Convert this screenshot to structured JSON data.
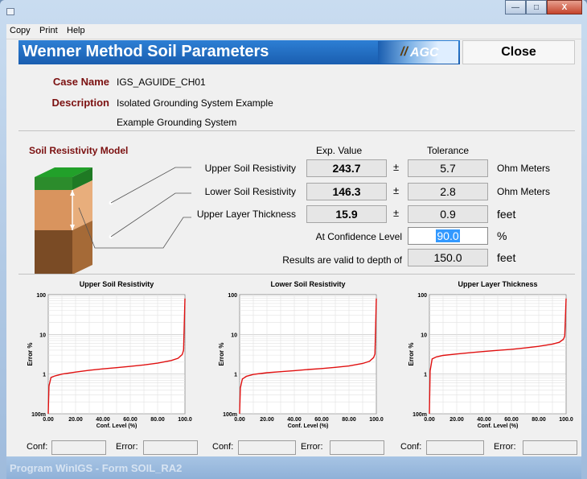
{
  "window": {
    "minimize": "—",
    "maximize": "□",
    "close": "X"
  },
  "menu": [
    "Copy",
    "Print",
    "Help"
  ],
  "header": {
    "title": "Wenner Method Soil Parameters",
    "logo": "AGC",
    "close_label": "Close"
  },
  "case": {
    "name_label": "Case Name",
    "name_value": "IGS_AGUIDE_CH01",
    "desc_label": "Description",
    "desc_value1": "Isolated Grounding System Example",
    "desc_value2": "Example Grounding System"
  },
  "model": {
    "title": "Soil Resistivity Model",
    "col_exp": "Exp. Value",
    "col_tol": "Tolerance",
    "rows": [
      {
        "label": "Upper Soil Resistivity",
        "value": "243.7",
        "pm": "±",
        "tol": "5.7",
        "unit": "Ohm Meters"
      },
      {
        "label": "Lower Soil Resistivity",
        "value": "146.3",
        "pm": "±",
        "tol": "2.8",
        "unit": "Ohm Meters"
      },
      {
        "label": "Upper Layer Thickness",
        "value": "15.9",
        "pm": "±",
        "tol": "0.9",
        "unit": "feet"
      }
    ],
    "confidence_label": "At Confidence Level",
    "confidence_value": "90.0",
    "confidence_unit": "%",
    "depth_label": "Results are valid to depth of",
    "depth_value": "150.0",
    "depth_unit": "feet"
  },
  "charts_text": {
    "ytick_labels": [
      "100",
      "10",
      "1",
      "100m"
    ],
    "xtick_labels": [
      "0.00",
      "20.00",
      "40.00",
      "60.00",
      "80.00",
      "100.0"
    ],
    "ylabel": "Error %",
    "xlabel": "Conf. Level (%)"
  },
  "chart_data": [
    {
      "type": "line",
      "title": "Upper Soil Resistivity",
      "xlabel": "Conf. Level (%)",
      "ylabel": "Error %",
      "xlim": [
        0,
        100
      ],
      "ylim": [
        0.1,
        100
      ],
      "y_scale": "log",
      "grid": true,
      "color": "#e01010",
      "x": [
        0,
        0.5,
        2,
        5,
        10,
        20,
        30,
        40,
        50,
        60,
        70,
        80,
        90,
        95,
        98,
        99,
        100
      ],
      "y": [
        0.1,
        0.5,
        0.82,
        0.9,
        1.0,
        1.12,
        1.25,
        1.35,
        1.45,
        1.56,
        1.7,
        1.88,
        2.2,
        2.5,
        3.1,
        4.0,
        80
      ]
    },
    {
      "type": "line",
      "title": "Lower Soil Resistivity",
      "xlabel": "Conf. Level (%)",
      "ylabel": "Error %",
      "xlim": [
        0,
        100
      ],
      "ylim": [
        0.1,
        100
      ],
      "y_scale": "log",
      "grid": true,
      "color": "#e01010",
      "x": [
        0,
        0.5,
        2,
        5,
        10,
        20,
        30,
        40,
        50,
        60,
        70,
        80,
        90,
        95,
        98,
        99,
        100
      ],
      "y": [
        0.1,
        0.45,
        0.75,
        0.88,
        0.98,
        1.08,
        1.15,
        1.22,
        1.3,
        1.38,
        1.48,
        1.6,
        1.85,
        2.1,
        2.6,
        3.2,
        80
      ]
    },
    {
      "type": "line",
      "title": "Upper Layer Thickness",
      "xlabel": "Conf. Level (%)",
      "ylabel": "Error %",
      "xlim": [
        0,
        100
      ],
      "ylim": [
        0.1,
        100
      ],
      "y_scale": "log",
      "grid": true,
      "color": "#e01010",
      "x": [
        0,
        0.5,
        2,
        5,
        10,
        20,
        30,
        40,
        50,
        60,
        70,
        80,
        90,
        95,
        98,
        99,
        100
      ],
      "y": [
        0.1,
        1.2,
        2.4,
        2.7,
        2.95,
        3.2,
        3.45,
        3.7,
        3.95,
        4.2,
        4.55,
        5.0,
        5.7,
        6.3,
        7.5,
        9.0,
        80
      ]
    }
  ],
  "footer": [
    {
      "conf": "Conf:",
      "error": "Error:"
    },
    {
      "conf": "Conf:",
      "error": "Error:"
    },
    {
      "conf": "Conf:",
      "error": "Error:"
    }
  ],
  "status": "Program WinIGS - Form SOIL_RA2"
}
